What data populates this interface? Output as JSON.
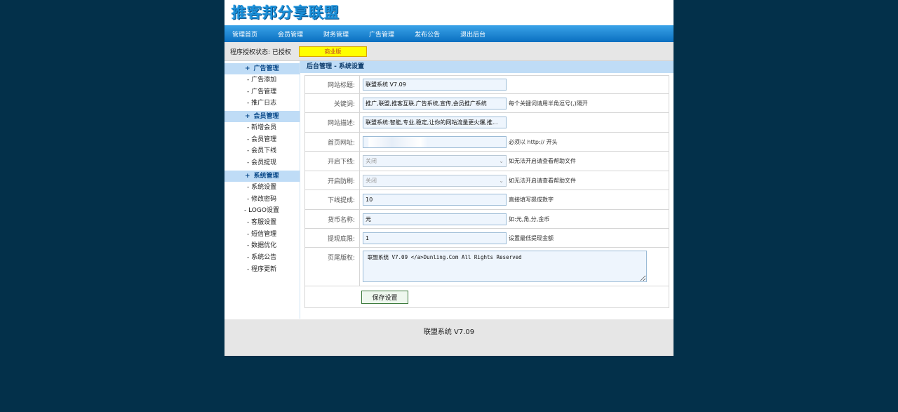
{
  "logo": "推客邦分享联盟",
  "nav": [
    "管理首页",
    "会员管理",
    "财务管理",
    "广告管理",
    "发布公告",
    "退出后台"
  ],
  "license": {
    "label": "程序授权状态: 已授权",
    "badge": "商业版"
  },
  "sidebar": {
    "groups": [
      {
        "title": "广告管理",
        "items": [
          "- 广告添加",
          "- 广告管理",
          "- 推广日志"
        ]
      },
      {
        "title": "会员管理",
        "items": [
          "- 新增会员",
          "- 会员管理",
          "- 会员下线",
          "- 会员提现"
        ]
      },
      {
        "title": "系统管理",
        "items": [
          "- 系统设置",
          "- 修改密码",
          "- LOGO设置",
          "- 客服设置",
          "- 短信管理",
          "- 数据优化",
          "- 系统公告",
          "- 程序更新"
        ]
      }
    ],
    "plus": "+"
  },
  "main": {
    "title": "后台管理 - 系统设置"
  },
  "form": {
    "site_title": {
      "label": "网站标题:",
      "value": "联盟系统 V7.09"
    },
    "keywords": {
      "label": "关键词:",
      "value": "推广,联盟,推客互联,广告系统,宣传,会员推广系统",
      "hint": "每个关键词请用半角逗号(,)隔开"
    },
    "description": {
      "label": "网站描述:",
      "value": "联盟系统:智能,专业,稳定,让你的网站流量更火爆,推..."
    },
    "homepage": {
      "label": "首页网址:",
      "value": "",
      "hint": "必须以 http:// 开头"
    },
    "downline": {
      "label": "开启下线:",
      "value": "关闭",
      "hint": "如无法开启请查看帮助文件"
    },
    "antispam": {
      "label": "开启防刷:",
      "value": "关闭",
      "hint": "如无法开启请查看帮助文件"
    },
    "commission": {
      "label": "下线提成:",
      "value": "10",
      "hint": "直接填写提成数字"
    },
    "currency": {
      "label": "货币名称:",
      "value": "元",
      "hint": "如:元,角,分,金币"
    },
    "min_withdraw": {
      "label": "提现底限:",
      "value": "1",
      "hint": "设置最低提现金额"
    },
    "copyright": {
      "label": "页尾版权:",
      "value": "联盟系统 V7.09 </a>Dunling.Com All Rights Reserved"
    },
    "save": "保存设置"
  },
  "footer": "联盟系统 V7.09"
}
